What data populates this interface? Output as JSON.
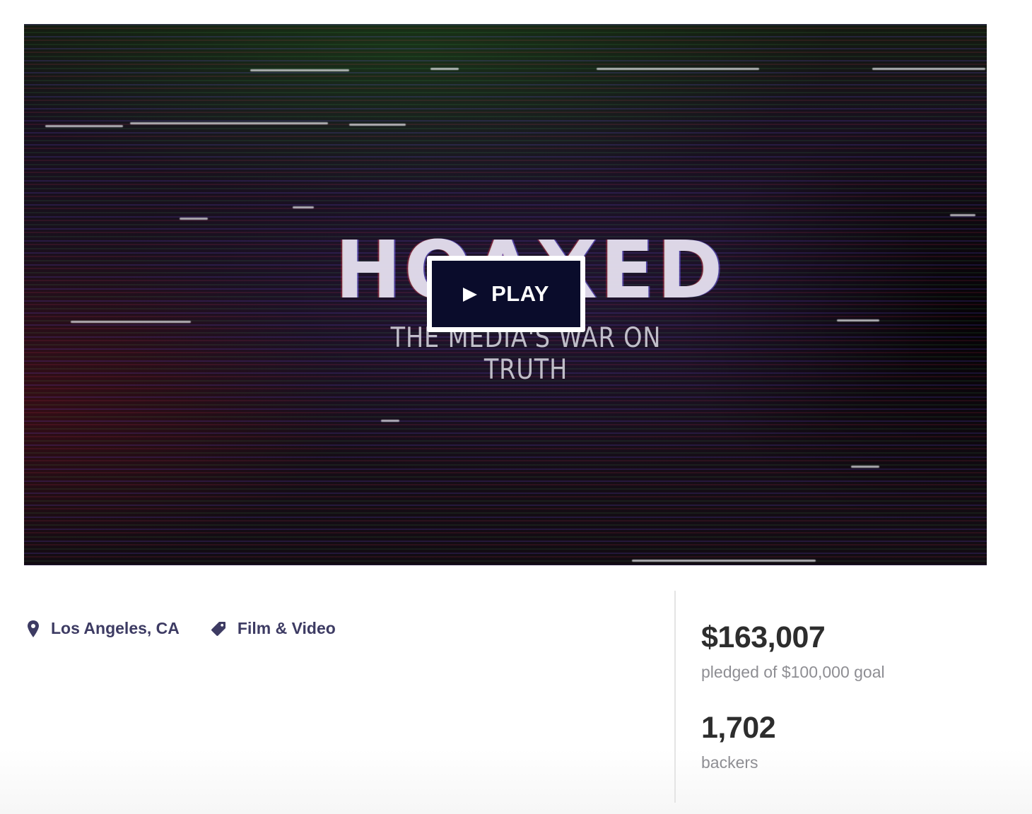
{
  "video": {
    "title_text": "HOAXED",
    "subtitle_text": "THE MEDIA'S WAR ON TRUTH",
    "play_label": "PLAY"
  },
  "meta": {
    "location": "Los Angeles, CA",
    "category": "Film & Video",
    "location_icon": "location-pin-icon",
    "category_icon": "tag-icon"
  },
  "stats": {
    "pledged_amount": "$163,007",
    "pledged_label": "pledged of $100,000 goal",
    "backers_count": "1,702",
    "backers_label": "backers"
  },
  "colors": {
    "accent": "#3d3b63",
    "play_button_bg": "#0a0c2b",
    "stat_value": "#2d2d2d",
    "stat_label": "#8e8e93"
  }
}
